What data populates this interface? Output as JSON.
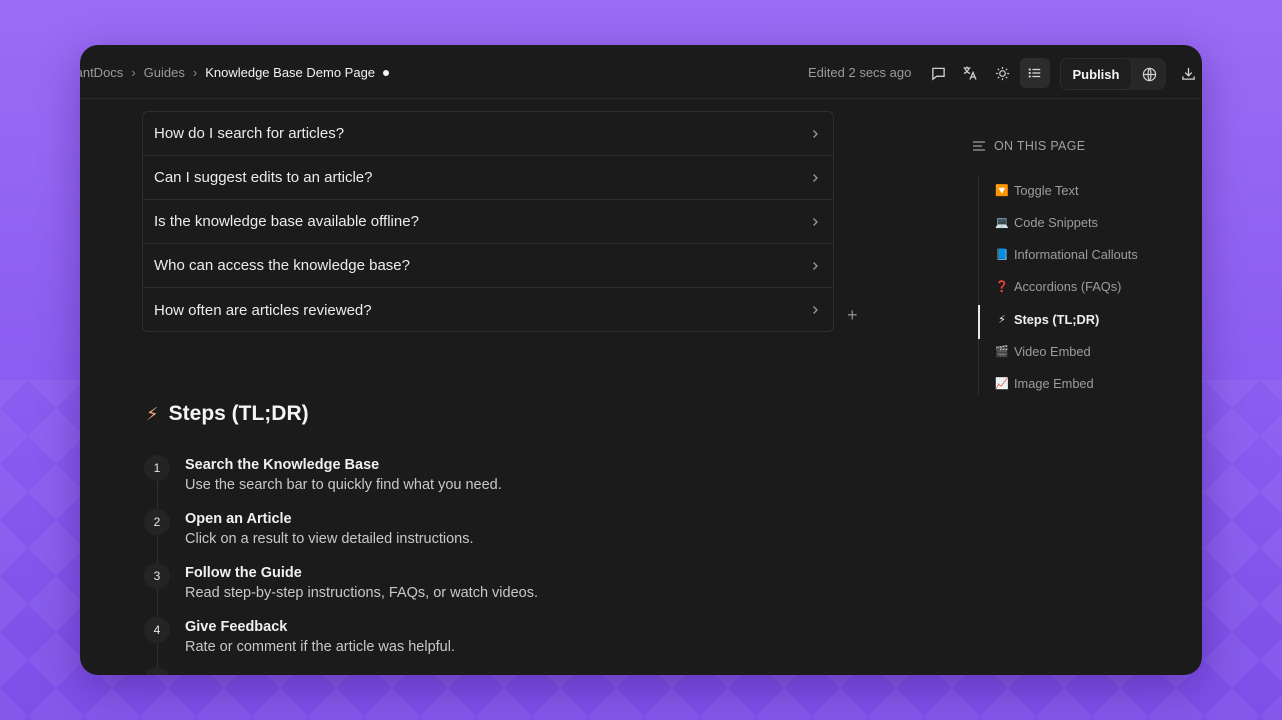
{
  "breadcrumb": {
    "items": [
      "tantDocs",
      "Guides"
    ],
    "current": "Knowledge Base Demo Page"
  },
  "header": {
    "edited": "Edited 2 secs ago",
    "publish_label": "Publish",
    "icons": [
      "comment-icon",
      "translate-icon",
      "theme-icon",
      "list-icon",
      "globe-icon",
      "download-icon"
    ]
  },
  "accordion": {
    "items": [
      {
        "label": "How do I search for articles?"
      },
      {
        "label": "Can I suggest edits to an article?"
      },
      {
        "label": "Is the knowledge base available offline?"
      },
      {
        "label": "Who can access the knowledge base?"
      },
      {
        "label": "How often are articles reviewed?"
      }
    ],
    "add_symbol": "+"
  },
  "steps_section": {
    "emoji": "⚡",
    "title": "Steps (TL;DR)",
    "steps": [
      {
        "number": "1",
        "title": "Search the Knowledge Base",
        "desc": "Use the search bar to quickly find what you need."
      },
      {
        "number": "2",
        "title": "Open an Article",
        "desc": "Click on a result to view detailed instructions."
      },
      {
        "number": "3",
        "title": "Follow the Guide",
        "desc": "Read step-by-step instructions, FAQs, or watch videos."
      },
      {
        "number": "4",
        "title": "Give Feedback",
        "desc": "Rate or comment if the article was helpful."
      }
    ]
  },
  "toc": {
    "heading": "ON THIS PAGE",
    "items": [
      {
        "icon": "🔽",
        "label": "Toggle Text"
      },
      {
        "icon": "💻",
        "label": "Code Snippets"
      },
      {
        "icon": "📘",
        "label": "Informational Callouts"
      },
      {
        "icon": "❓",
        "label": "Accordions (FAQs)"
      },
      {
        "icon": "⚡",
        "label": "Steps (TL;DR)",
        "active": true
      },
      {
        "icon": "🎬",
        "label": "Video Embed"
      },
      {
        "icon": "📈",
        "label": "Image Embed"
      }
    ]
  }
}
